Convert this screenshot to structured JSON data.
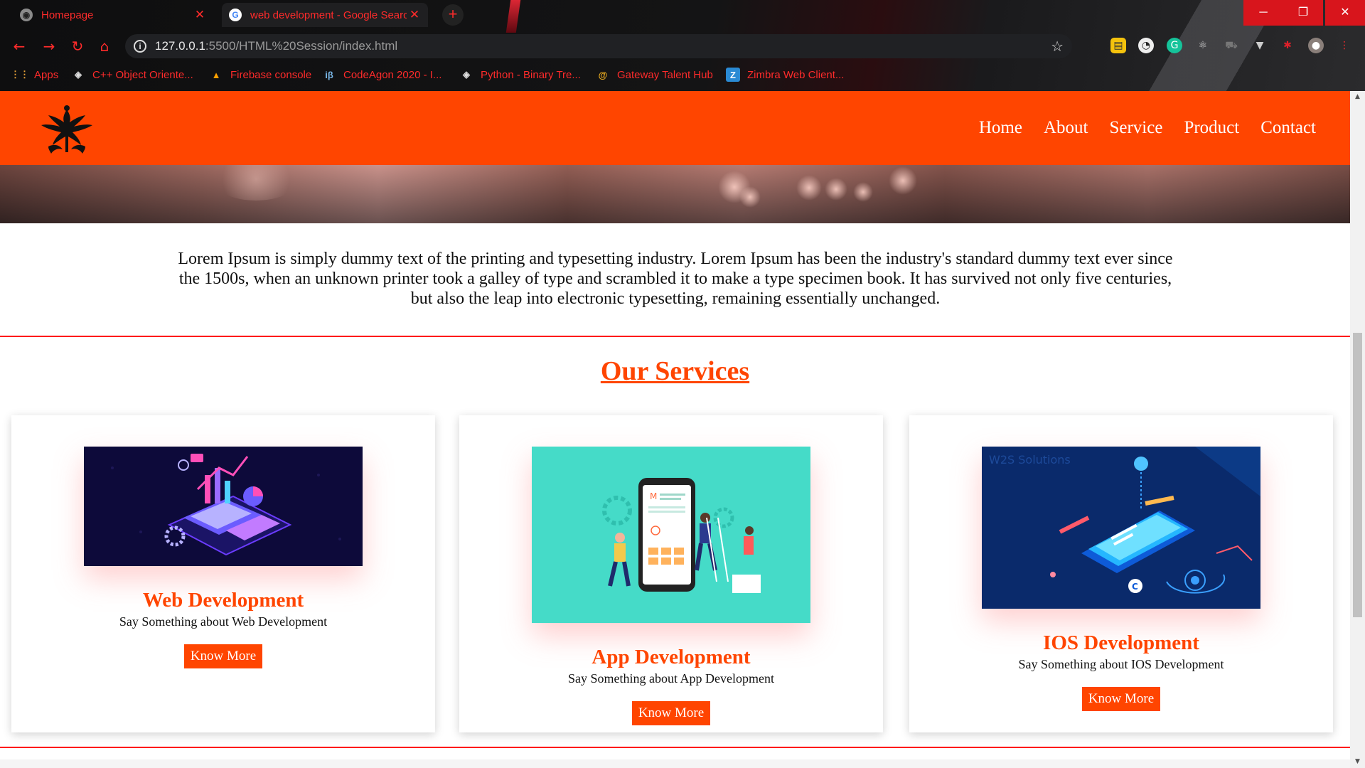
{
  "browser": {
    "tabs": [
      {
        "title": "Homepage",
        "favicon": "globe-icon"
      },
      {
        "title": "web development - Google Search",
        "favicon": "google-icon"
      }
    ],
    "new_tab_label": "+",
    "url_host": "127.0.0.1",
    "url_rest": ":5500/HTML%20Session/index.html",
    "window_controls": {
      "minimize": "─",
      "maximize": "❐",
      "close": "✕"
    },
    "bookmarks": [
      {
        "label": "Apps",
        "icon": "apps-grid-icon"
      },
      {
        "label": "C++ Object Oriente...",
        "icon": "diamond-logo-icon"
      },
      {
        "label": "Firebase console",
        "icon": "firebase-flame-icon"
      },
      {
        "label": "CodeAgon 2020 - I...",
        "icon": "ib-icon",
        "icon_text": "iβ"
      },
      {
        "label": "Python - Binary Tre...",
        "icon": "diamond-logo-icon"
      },
      {
        "label": "Gateway Talent Hub",
        "icon": "swirl-icon"
      },
      {
        "label": "Zimbra Web Client...",
        "icon": "zimbra-icon",
        "icon_text": "Z"
      }
    ],
    "accent_color": "#ff2b2b"
  },
  "site": {
    "brand_color": "#ff4500",
    "nav": [
      "Home",
      "About",
      "Service",
      "Product",
      "Contact"
    ],
    "intro": "Lorem Ipsum is simply dummy text of the printing and typesetting industry. Lorem Ipsum has been the industry's standard dummy text ever since the 1500s, when an unknown printer took a galley of type and scrambled it to make a type specimen book. It has survived not only five centuries, but also the leap into electronic typesetting, remaining essentially unchanged.",
    "services_title": "Our Services",
    "cards": [
      {
        "title": "Web Development",
        "desc": "Say Something about Web Development",
        "button": "Know More",
        "image": "isometric-laptop-illustration"
      },
      {
        "title": "App Development",
        "desc": "Say Something about App Development",
        "button": "Know More",
        "image": "mobile-app-team-illustration"
      },
      {
        "title": "IOS Development",
        "desc": "Say Something about IOS Development",
        "button": "Know More",
        "image": "iphone-isometric-illustration",
        "watermark": "W2S Solutions"
      }
    ]
  }
}
